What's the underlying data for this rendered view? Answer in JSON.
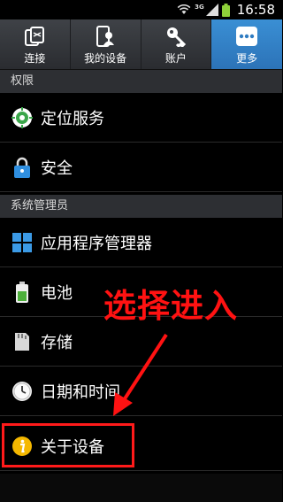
{
  "status_bar": {
    "time": "16:58",
    "network": "3G"
  },
  "tabs": [
    {
      "label": "连接",
      "icon": "connections-icon",
      "active": false
    },
    {
      "label": "我的设备",
      "icon": "my-device-icon",
      "active": false
    },
    {
      "label": "账户",
      "icon": "accounts-icon",
      "active": false
    },
    {
      "label": "更多",
      "icon": "more-icon",
      "active": true
    }
  ],
  "sections": [
    {
      "header": "权限",
      "items": [
        {
          "label": "定位服务",
          "icon": "location-icon"
        },
        {
          "label": "安全",
          "icon": "lock-icon"
        }
      ]
    },
    {
      "header": "系统管理员",
      "items": [
        {
          "label": "应用程序管理器",
          "icon": "apps-grid-icon"
        },
        {
          "label": "电池",
          "icon": "battery-icon"
        },
        {
          "label": "存储",
          "icon": "storage-icon"
        },
        {
          "label": "日期和时间",
          "icon": "clock-icon"
        },
        {
          "label": "关于设备",
          "icon": "info-icon"
        }
      ]
    }
  ],
  "annotation": {
    "text": "选择进入",
    "color": "#ff1212"
  },
  "colors": {
    "active_tab": "#2f7cc2",
    "section_header_bg": "#2d2f33",
    "background": "#000000"
  }
}
